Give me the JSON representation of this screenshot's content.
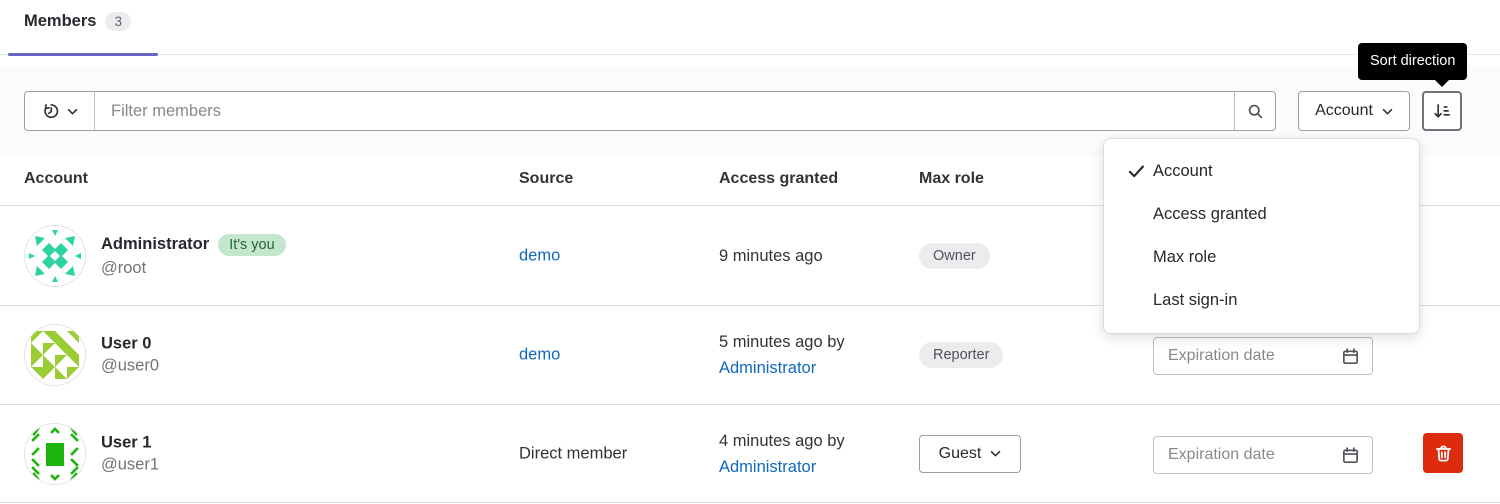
{
  "colors": {
    "tab_indicator": "#6666c4",
    "link": "#1068bf",
    "danger": "#dd2b0e",
    "badge_success_bg": "#c3e6cd",
    "badge_success_text": "#24663b",
    "badge_neutral_bg": "#ececef",
    "badge_neutral_text": "#535158",
    "avatar_root": "#2dd4a0",
    "avatar_user0": "#9acc33",
    "avatar_user1": "#1db30e"
  },
  "tabs": {
    "members_label": "Members",
    "members_count": "3"
  },
  "filter_bar": {
    "placeholder": "Filter members",
    "sort_by_label": "Account",
    "tooltip": "Sort direction"
  },
  "sort_menu": {
    "items": [
      {
        "label": "Account",
        "checked": true
      },
      {
        "label": "Access granted",
        "checked": false
      },
      {
        "label": "Max role",
        "checked": false
      },
      {
        "label": "Last sign-in",
        "checked": false
      }
    ]
  },
  "table": {
    "headers": {
      "account": "Account",
      "source": "Source",
      "access_granted": "Access granted",
      "max_role": "Max role"
    },
    "rows": [
      {
        "name": "Administrator",
        "self_badge": "It's you",
        "username": "@root",
        "source": "demo",
        "access": "9 minutes ago",
        "role": "Owner"
      },
      {
        "name": "User 0",
        "username": "@user0",
        "source": "demo",
        "access": "5 minutes ago by",
        "access_by": "Administrator",
        "role": "Reporter",
        "expiration_placeholder": "Expiration date"
      },
      {
        "name": "User 1",
        "username": "@user1",
        "source": "Direct member",
        "access": "4 minutes ago by",
        "access_by": "Administrator",
        "role": "Guest",
        "expiration_placeholder": "Expiration date"
      }
    ]
  }
}
